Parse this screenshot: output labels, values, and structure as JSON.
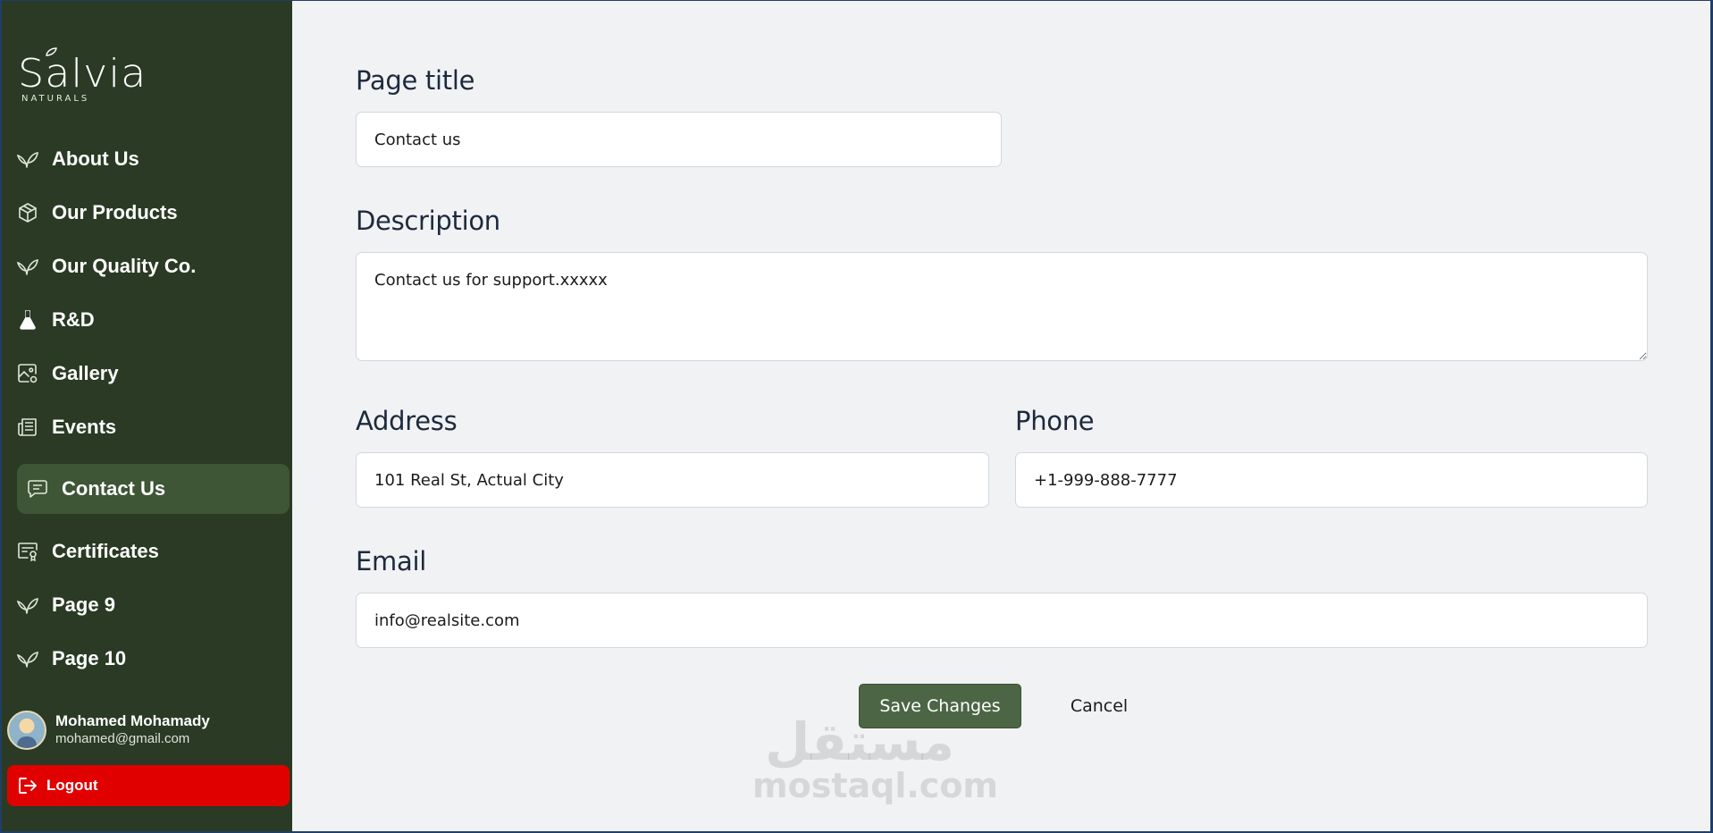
{
  "brand": {
    "name": "Salvia",
    "tagline": "NATURALS"
  },
  "sidebar": {
    "items": [
      {
        "label": "About Us",
        "icon": "leaf-icon",
        "active": false
      },
      {
        "label": "Our Products",
        "icon": "box-icon",
        "active": false
      },
      {
        "label": "Our Quality Co.",
        "icon": "leaf-icon",
        "active": false
      },
      {
        "label": "R&D",
        "icon": "flask-icon",
        "active": false
      },
      {
        "label": "Gallery",
        "icon": "image-gear-icon",
        "active": false
      },
      {
        "label": "Events",
        "icon": "newspaper-icon",
        "active": false
      },
      {
        "label": "Contact Us",
        "icon": "message-icon",
        "active": true
      },
      {
        "label": "Certificates",
        "icon": "certificate-icon",
        "active": false
      },
      {
        "label": "Page 9",
        "icon": "leaf-icon",
        "active": false
      },
      {
        "label": "Page 10",
        "icon": "leaf-icon",
        "active": false
      }
    ],
    "user": {
      "name": "Mohamed Mohamady",
      "email": "mohamed@gmail.com"
    },
    "logout_label": "Logout"
  },
  "form": {
    "page_title": {
      "label": "Page title",
      "value": "Contact us"
    },
    "description": {
      "label": "Description",
      "value": "Contact us for support.xxxxx"
    },
    "address": {
      "label": "Address",
      "value": "101 Real St, Actual City"
    },
    "phone": {
      "label": "Phone",
      "value": "+1-999-888-7777"
    },
    "email": {
      "label": "Email",
      "value": "info@realsite.com"
    },
    "save_label": "Save Changes",
    "cancel_label": "Cancel"
  },
  "watermark": {
    "arabic": "مستقل",
    "latin": "mostaql.com"
  },
  "colors": {
    "sidebar_bg": "#2a3a24",
    "active_item_bg": "#3e5536",
    "logout_bg": "#e00000",
    "save_button_bg": "#4c6645",
    "content_bg": "#f1f2f4"
  }
}
